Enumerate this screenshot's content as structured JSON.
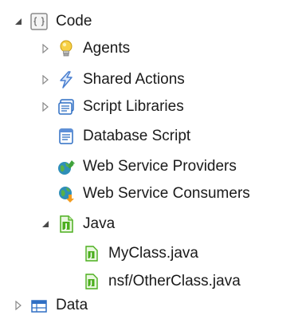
{
  "tree": {
    "code": {
      "label": "Code",
      "icon": "code-folder-icon",
      "expanded": true
    },
    "agents": {
      "label": "Agents",
      "icon": "lightbulb-icon",
      "expanded": false
    },
    "shared_actions": {
      "label": "Shared Actions",
      "icon": "lightning-icon",
      "expanded": false
    },
    "script_libraries": {
      "label": "Script Libraries",
      "icon": "script-library-icon",
      "expanded": false
    },
    "database_script": {
      "label": "Database Script",
      "icon": "database-script-icon"
    },
    "web_service_providers": {
      "label": "Web Service Providers",
      "icon": "web-service-provider-icon"
    },
    "web_service_consumers": {
      "label": "Web Service Consumers",
      "icon": "web-service-consumer-icon"
    },
    "java": {
      "label": "Java",
      "icon": "java-folder-icon",
      "expanded": true
    },
    "myclass": {
      "label": "MyClass.java",
      "icon": "java-file-icon"
    },
    "otherclass": {
      "label": "nsf/OtherClass.java",
      "icon": "java-file-icon"
    },
    "data": {
      "label": "Data",
      "icon": "data-folder-icon",
      "expanded": false
    }
  },
  "colors": {
    "java_green": "#4caf1e",
    "lightbulb_yellow": "#f5c425",
    "lightning_blue": "#4a7fd0",
    "script_blue": "#2f6fc4",
    "twisty_gray": "#6a6a6a"
  }
}
